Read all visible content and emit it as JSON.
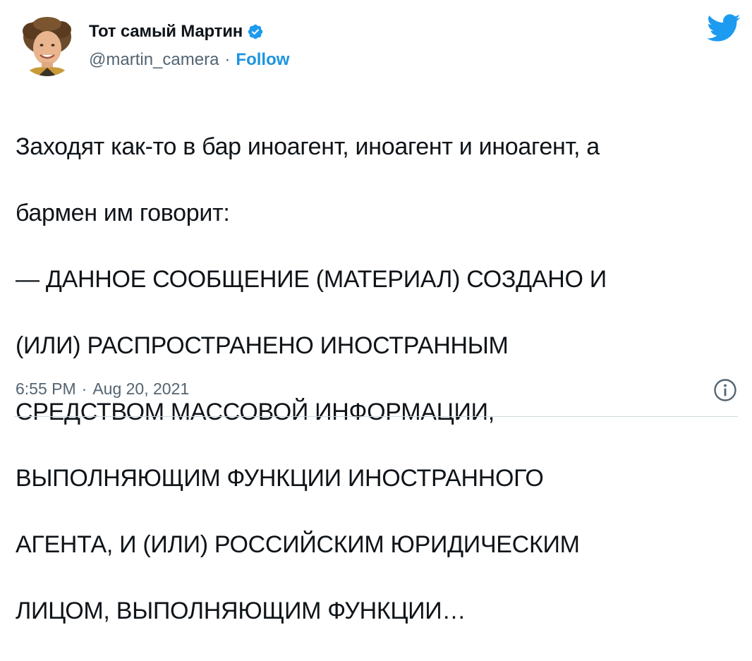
{
  "author": {
    "display_name": "Тот самый Мартин",
    "handle": "@martin_camera",
    "separator": "·",
    "follow_label": "Follow",
    "verified": true
  },
  "tweet": {
    "lines": [
      "Заходят как-то в бар иноагент, иноагент и иноагент, а",
      "бармен им говорит:",
      "— ДАННОЕ СООБЩЕНИЕ (МАТЕРИАЛ) СОЗДАНО И",
      "(ИЛИ) РАСПРОСТРАНЕНО ИНОСТРАННЫМ",
      "СРЕДСТВОМ МАССОВОЙ ИНФОРМАЦИИ,",
      "ВЫПОЛНЯЮЩИМ ФУНКЦИИ ИНОСТРАННОГО",
      "АГЕНТА, И (ИЛИ) РОССИЙСКИМ ЮРИДИЧЕСКИМ",
      "ЛИЦОМ, ВЫПОЛНЯЮЩИМ ФУНКЦИИ…"
    ]
  },
  "footer": {
    "time": "6:55 PM",
    "separator": "·",
    "date": "Aug 20, 2021"
  },
  "icons": {
    "logo": "twitter-bird-icon",
    "verified": "verified-badge-icon",
    "info": "info-icon"
  },
  "colors": {
    "text": "#0f1419",
    "secondary": "#536471",
    "link": "#1b95e0",
    "twitter_blue": "#1d9bf0",
    "divider": "#cfd9de"
  }
}
